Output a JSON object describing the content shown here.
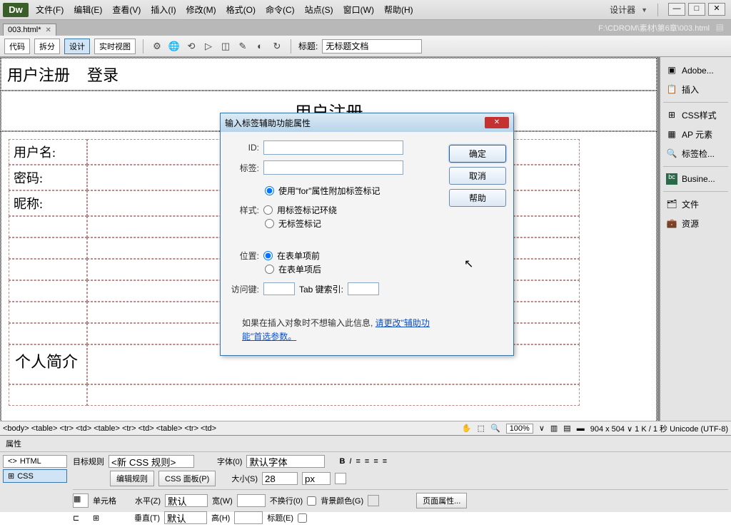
{
  "app": {
    "logo": "Dw"
  },
  "menu": {
    "file": "文件(F)",
    "edit": "编辑(E)",
    "view": "查看(V)",
    "insert": "插入(I)",
    "modify": "修改(M)",
    "format": "格式(O)",
    "commands": "命令(C)",
    "site": "站点(S)",
    "window": "窗口(W)",
    "help": "帮助(H)"
  },
  "titlebar": {
    "designer": "设计器",
    "search_icon": "🔍"
  },
  "doctab": {
    "name": "003.html*",
    "path": "F:\\CDROM\\素材\\第6章\\003.html"
  },
  "toolbar": {
    "code": "代码",
    "split": "拆分",
    "design": "设计",
    "live": "实时视图",
    "title_label": "标题:",
    "title_value": "无标题文档"
  },
  "page": {
    "tab1": "用户注册",
    "tab2": "登录",
    "heading": "用户注册",
    "labels": {
      "username": "用户名:",
      "password": "密码:",
      "nickname": "昵称:"
    },
    "intro": "个人简介"
  },
  "dialog": {
    "title": "输入标签辅助功能属性",
    "ok": "确定",
    "cancel": "取消",
    "help": "帮助",
    "id_label": "ID:",
    "label_label": "标签:",
    "style_label": "样式:",
    "radio1": "使用\"for\"属性附加标签标记",
    "radio2": "用标签标记环绕",
    "radio3": "无标签标记",
    "position_label": "位置:",
    "pos1": "在表单项前",
    "pos2": "在表单项后",
    "access_label": "访问键:",
    "tab_label": "Tab 键索引:",
    "hint_prefix": "如果在插入对象时不想输入此信息, ",
    "hint_link": "请更改\"辅助功能\"首选参数。"
  },
  "tagbar": {
    "path": "<body> <table> <tr> <td> <table> <tr> <td> <table> <tr> <td>",
    "zoom": "100%",
    "status": "904 x 504 ∨ 1 K / 1 秒 Unicode (UTF-8)"
  },
  "props": {
    "title": "属性",
    "tab_html": "HTML",
    "tab_css": "CSS",
    "target_rule_label": "目标规则",
    "target_rule_value": "<新 CSS 规则>",
    "edit_rule": "编辑规则",
    "css_panel": "CSS 面板(P)",
    "font_label": "字体(0)",
    "font_value": "默认字体",
    "size_label": "大小(S)",
    "size_value": "28",
    "size_unit": "px",
    "cell_label": "单元格",
    "horiz_label": "水平(Z)",
    "horiz_value": "默认",
    "width_label": "宽(W)",
    "nowrap_label": "不换行(0)",
    "bgcolor_label": "背景颜色(G)",
    "vert_label": "垂直(T)",
    "vert_value": "默认",
    "height_label": "高(H)",
    "header_label": "标题(E)",
    "page_props": "页面属性..."
  },
  "dock": {
    "adobe": "Adobe...",
    "insert": "插入",
    "css": "CSS样式",
    "ap": "AP 元素",
    "tag": "标签检...",
    "busine": "Busine...",
    "files": "文件",
    "assets": "资源"
  }
}
